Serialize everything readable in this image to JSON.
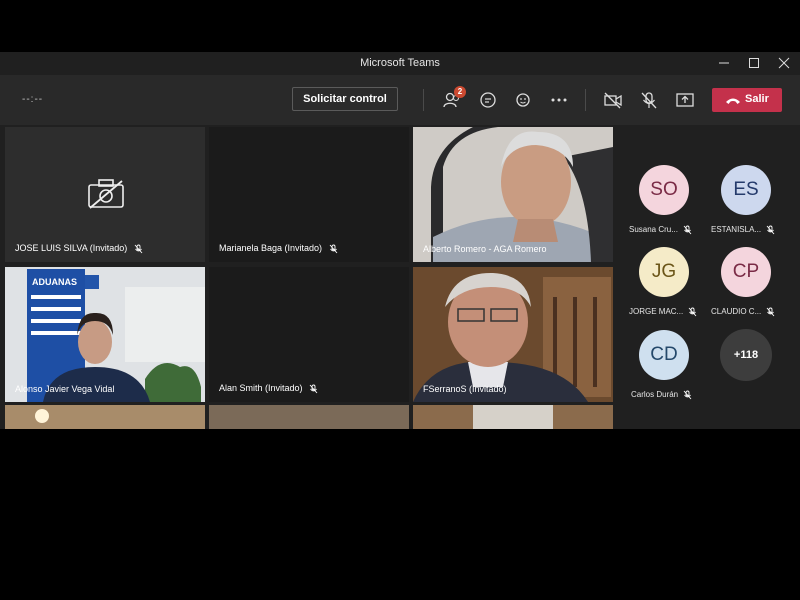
{
  "window": {
    "title": "Microsoft Teams"
  },
  "toolbar": {
    "timer": "--:--",
    "request_control_label": "Solicitar control",
    "participants_badge": "2",
    "leave_label": "Salir"
  },
  "tiles": [
    {
      "name": "JOSE LUIS SILVA (Invitado)"
    },
    {
      "name": "Marianela Baga (Invitado)"
    },
    {
      "name": "Alberto Romero - AGA Romero"
    },
    {
      "name": "Alonso Javier Vega Vidal"
    },
    {
      "name": "Alan Smith (Invitado)"
    },
    {
      "name": "FSerranoS (Invitado)"
    }
  ],
  "video_banner_text": "ADUANAS",
  "roster": [
    {
      "initials": "SO",
      "name": "Susana Cru...",
      "bg": "#f4d5dd",
      "fg": "#7a2b46"
    },
    {
      "initials": "ES",
      "name": "ESTANISLA...",
      "bg": "#cdd8ee",
      "fg": "#243a6b"
    },
    {
      "initials": "JG",
      "name": "JORGE MAC...",
      "bg": "#f5ebc8",
      "fg": "#6b5518"
    },
    {
      "initials": "CP",
      "name": "CLAUDIO C...",
      "bg": "#f4d5dd",
      "fg": "#7a2b46"
    },
    {
      "initials": "CD",
      "name": "Carlos Durán",
      "bg": "#cfe0ef",
      "fg": "#25496b"
    }
  ],
  "more_participants": "+118",
  "colors": {
    "leave": "#c4314b",
    "active_border": "#7f85d5",
    "badge": "#cc4a31"
  }
}
